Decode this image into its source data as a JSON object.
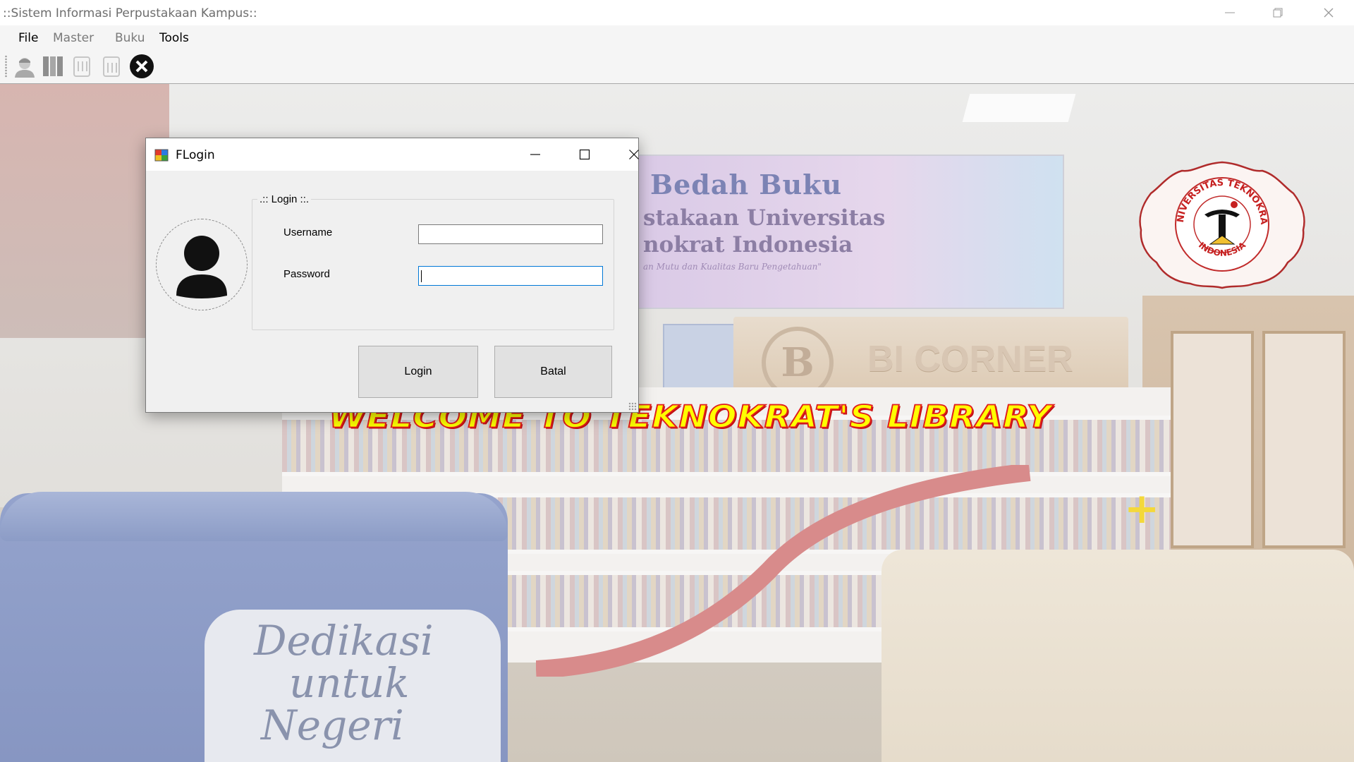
{
  "window": {
    "title": "::Sistem Informasi Perpustakaan Kampus::",
    "controls": [
      "minimize-icon",
      "restore-icon",
      "close-icon"
    ]
  },
  "menubar": {
    "items": [
      {
        "label": "File",
        "enabled": true
      },
      {
        "label": "Master",
        "enabled": false
      },
      {
        "label": "Buku",
        "enabled": false
      },
      {
        "label": "Tools",
        "enabled": true
      }
    ]
  },
  "toolbar": {
    "buttons": [
      {
        "icon": "user-icon",
        "enabled": false
      },
      {
        "icon": "books-icon",
        "enabled": false
      },
      {
        "icon": "borrow-icon",
        "enabled": false
      },
      {
        "icon": "return-icon",
        "enabled": false
      },
      {
        "icon": "exit-icon",
        "enabled": true
      }
    ]
  },
  "background": {
    "banner_line1": "Bedah Buku",
    "banner_line2": "stakaan Universitas",
    "banner_line3": "nokrat Indonesia",
    "banner_line4": "an Mutu dan Kualitas Baru Pengetahuan\"",
    "bi_logo": "B",
    "bi_text": "BI CORNER",
    "desk_line1": "Dedikasi",
    "desk_line2": "untuk",
    "desk_line3": "Negeri",
    "welcome": "WELCOME TO TEKNOKRAT'S LIBRARY",
    "logo_top": "UNIVERSITAS TEKNOKRAT",
    "logo_bottom": "INDONESIA"
  },
  "dialog": {
    "title": "FLogin",
    "group_label": ".:: Login ::.",
    "username_label": "Username",
    "username_value": "",
    "password_label": "Password",
    "password_value": "",
    "login_button": "Login",
    "cancel_button": "Batal"
  },
  "colors": {
    "welcome_fill": "#ffff00",
    "welcome_stroke": "#e11d1d",
    "focus_border": "#0078d7",
    "disabled_text": "#6d6d6d"
  }
}
